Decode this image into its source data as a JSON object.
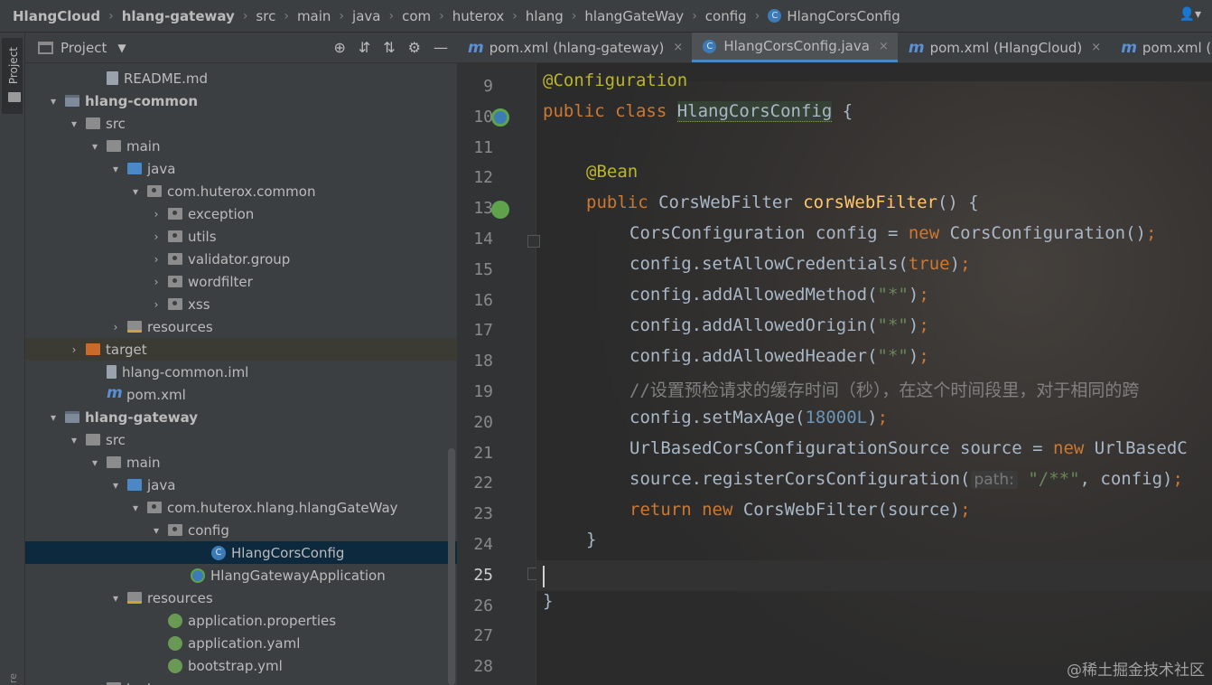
{
  "breadcrumb": {
    "items": [
      "HlangCloud",
      "hlang-gateway",
      "src",
      "main",
      "java",
      "com",
      "huterox",
      "hlang",
      "hlangGateWay",
      "config",
      "HlangCorsConfig"
    ]
  },
  "left_strip": {
    "project_tab": "Project",
    "bottom_tab": "re"
  },
  "project_panel": {
    "title": "Project",
    "tree": [
      {
        "depth": 3,
        "arrow": "",
        "icon": "file",
        "label": "README.md",
        "bold": false
      },
      {
        "depth": 1,
        "arrow": "▾",
        "icon": "module",
        "label": "hlang-common",
        "bold": true
      },
      {
        "depth": 2,
        "arrow": "▾",
        "icon": "folder",
        "label": "src",
        "bold": false
      },
      {
        "depth": 3,
        "arrow": "▾",
        "icon": "folder",
        "label": "main",
        "bold": false
      },
      {
        "depth": 4,
        "arrow": "▾",
        "icon": "java",
        "label": "java",
        "bold": false
      },
      {
        "depth": 5,
        "arrow": "▾",
        "icon": "package",
        "label": "com.huterox.common",
        "bold": false
      },
      {
        "depth": 6,
        "arrow": "›",
        "icon": "package",
        "label": "exception",
        "bold": false
      },
      {
        "depth": 6,
        "arrow": "›",
        "icon": "package",
        "label": "utils",
        "bold": false
      },
      {
        "depth": 6,
        "arrow": "›",
        "icon": "package",
        "label": "validator.group",
        "bold": false
      },
      {
        "depth": 6,
        "arrow": "›",
        "icon": "package",
        "label": "wordfilter",
        "bold": false
      },
      {
        "depth": 6,
        "arrow": "›",
        "icon": "package",
        "label": "xss",
        "bold": false
      },
      {
        "depth": 4,
        "arrow": "›",
        "icon": "resources",
        "label": "resources",
        "bold": false
      },
      {
        "depth": 2,
        "arrow": "›",
        "icon": "target",
        "label": "target",
        "bold": false,
        "excluded": true
      },
      {
        "depth": 3,
        "arrow": "",
        "icon": "iml",
        "label": "hlang-common.iml",
        "bold": false
      },
      {
        "depth": 3,
        "arrow": "",
        "icon": "maven",
        "label": "pom.xml",
        "bold": false
      },
      {
        "depth": 1,
        "arrow": "▾",
        "icon": "module",
        "label": "hlang-gateway",
        "bold": true
      },
      {
        "depth": 2,
        "arrow": "▾",
        "icon": "folder",
        "label": "src",
        "bold": false
      },
      {
        "depth": 3,
        "arrow": "▾",
        "icon": "folder",
        "label": "main",
        "bold": false
      },
      {
        "depth": 4,
        "arrow": "▾",
        "icon": "java",
        "label": "java",
        "bold": false
      },
      {
        "depth": 5,
        "arrow": "▾",
        "icon": "package",
        "label": "com.huterox.hlang.hlangGateWay",
        "bold": false
      },
      {
        "depth": 6,
        "arrow": "▾",
        "icon": "package",
        "label": "config",
        "bold": false
      },
      {
        "depth": 8,
        "arrow": "",
        "icon": "cls",
        "label": "HlangCorsConfig",
        "bold": false,
        "selected": true
      },
      {
        "depth": 7,
        "arrow": "",
        "icon": "springapp",
        "label": "HlangGatewayApplication",
        "bold": false
      },
      {
        "depth": 4,
        "arrow": "▾",
        "icon": "resources",
        "label": "resources",
        "bold": false
      },
      {
        "depth": 6,
        "arrow": "",
        "icon": "spring",
        "label": "application.properties",
        "bold": false
      },
      {
        "depth": 6,
        "arrow": "",
        "icon": "spring",
        "label": "application.yaml",
        "bold": false
      },
      {
        "depth": 6,
        "arrow": "",
        "icon": "spring",
        "label": "bootstrap.yml",
        "bold": false
      },
      {
        "depth": 3,
        "arrow": "›",
        "icon": "folder",
        "label": "test",
        "bold": false
      }
    ]
  },
  "editor": {
    "tabs": [
      {
        "icon": "m",
        "label": "pom.xml (hlang-gateway)",
        "active": false,
        "close": "×"
      },
      {
        "icon": "c",
        "label": "HlangCorsConfig.java",
        "active": true,
        "close": "×"
      },
      {
        "icon": "m",
        "label": "pom.xml (HlangCloud)",
        "active": false,
        "close": "×"
      },
      {
        "icon": "m",
        "label": "pom.xml (hlang",
        "active": false,
        "close": ""
      }
    ],
    "line_numbers": [
      "9",
      "10",
      "11",
      "12",
      "13",
      "14",
      "15",
      "16",
      "17",
      "18",
      "19",
      "20",
      "21",
      "22",
      "23",
      "24",
      "25",
      "26",
      "27",
      "28"
    ],
    "current_line": "25",
    "code": {
      "l9": "@Configuration",
      "l10_kw": "public class ",
      "l10_cls": "HlangCorsConfig",
      "l10_rest": " {",
      "l12": "@Bean",
      "l13_kw": "public ",
      "l13_type": "CorsWebFilter ",
      "l13_fn": "corsWebFilter",
      "l13_rest": "() {",
      "l14_a": "CorsConfiguration config = ",
      "l14_kw": "new ",
      "l14_b": "CorsConfiguration()",
      "l14_semi": ";",
      "l15_a": "config.setAllowCredentials(",
      "l15_kw": "true",
      "l15_b": ")",
      "l15_semi": ";",
      "l16_a": "config.addAllowedMethod(",
      "l16_str": "\"*\"",
      "l16_b": ")",
      "l16_semi": ";",
      "l17_a": "config.addAllowedOrigin(",
      "l17_str": "\"*\"",
      "l17_b": ")",
      "l17_semi": ";",
      "l18_a": "config.addAllowedHeader(",
      "l18_str": "\"*\"",
      "l18_b": ")",
      "l18_semi": ";",
      "l19": "//设置预检请求的缓存时间（秒），在这个时间段里，对于相同的跨",
      "l20_a": "config.setMaxAge(",
      "l20_num": "18000L",
      "l20_b": ")",
      "l20_semi": ";",
      "l21_a": "UrlBasedCorsConfigurationSource source = ",
      "l21_kw": "new ",
      "l21_b": "UrlBasedC",
      "l22_a": "source.registerCorsConfiguration(",
      "l22_hint": "path:",
      "l22_str": "\"/**\"",
      "l22_b": ", config)",
      "l22_semi": ";",
      "l23_kw1": "return ",
      "l23_kw2": "new ",
      "l23_b": "CorsWebFilter(source)",
      "l23_semi": ";",
      "l24": "}",
      "l26": "}"
    }
  },
  "watermark": "@稀土掘金技术社区"
}
